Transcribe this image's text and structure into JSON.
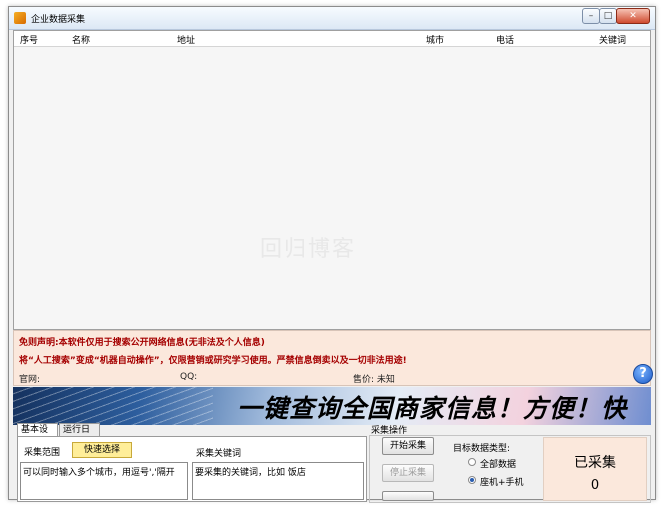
{
  "window": {
    "title": "企业数据采集"
  },
  "table": {
    "columns": [
      "序号",
      "名称",
      "地址",
      "城市",
      "电话",
      "关键词"
    ],
    "rows": []
  },
  "watermark": "回归博客",
  "notice": {
    "disclaimer": "免则声明:本软件仅用于搜索公开网络信息(无非法及个人信息)",
    "statement": "将“人工搜索”变成“机器自动操作”，仅限营销或研究学习使用。严禁信息倒卖以及一切非法用途!",
    "website_label": "官网:",
    "qq_label": "QQ:",
    "price_label": "售价: 未知"
  },
  "banner": {
    "text": "一键查询全国商家信息！方便！快捷！"
  },
  "tabs": [
    {
      "label": "基本设置",
      "active": true
    },
    {
      "label": "运行日志",
      "active": false
    }
  ],
  "settings": {
    "scope_label": "采集范围",
    "quick_select": "快速选择",
    "keywords_label": "采集关键词",
    "city_input": "可以同时输入多个城市，用逗号','隔开",
    "keyword_input": "要采集的关键词，比如 饭店"
  },
  "operations": {
    "group_title": "采集操作",
    "start": "开始采集",
    "stop": "停止采集",
    "target_type_label": "目标数据类型:",
    "options": [
      {
        "label": "全部数据",
        "checked": false
      },
      {
        "label": "座机+手机",
        "checked": true
      }
    ],
    "collected_label": "已采集",
    "collected_count": "0"
  },
  "colors": {
    "notice_bg": "#fbe8dc",
    "notice_text": "#a50000",
    "accent": "#2a5db0"
  }
}
